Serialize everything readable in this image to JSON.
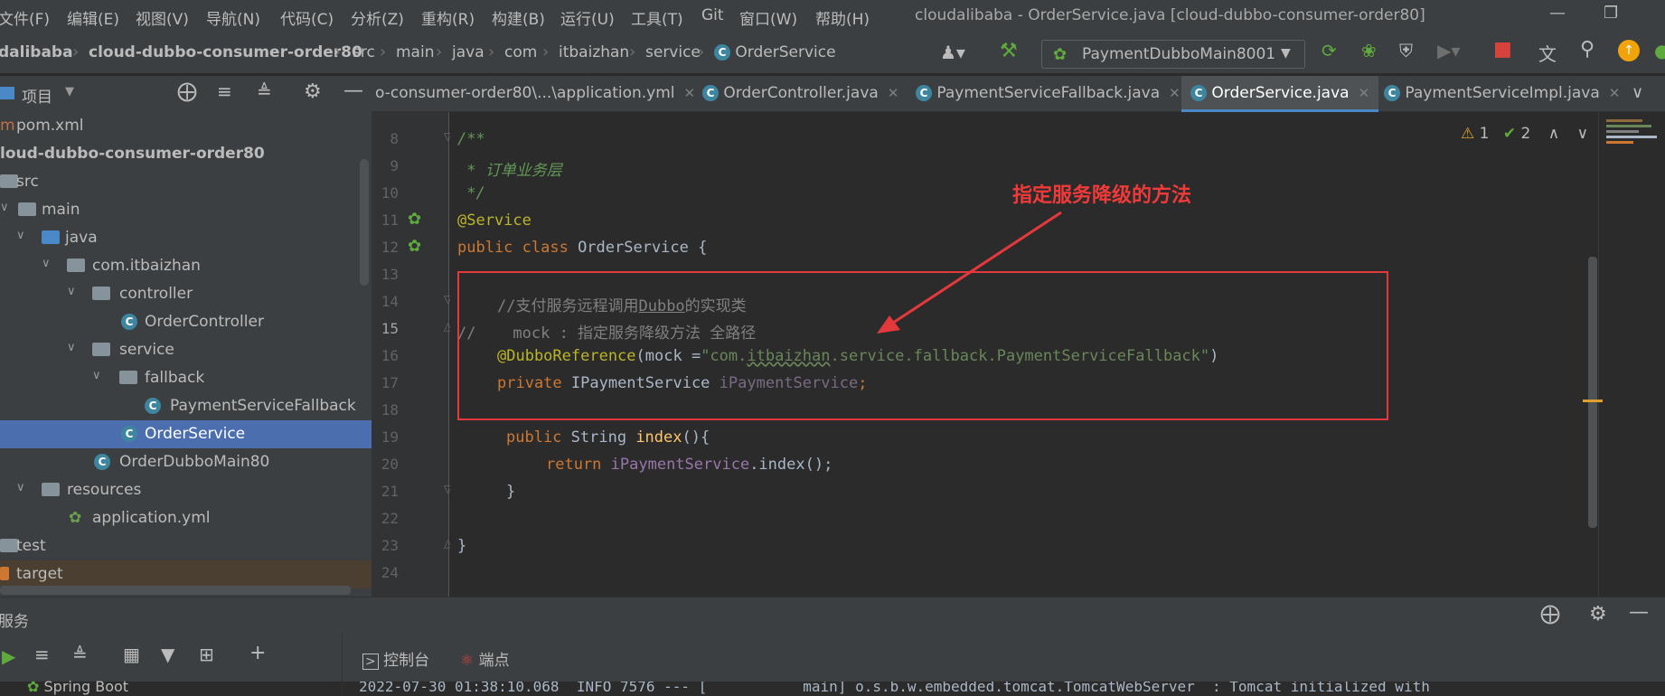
{
  "menu": [
    "文件(F)",
    "编辑(E)",
    "视图(V)",
    "导航(N)",
    "代码(C)",
    "分析(Z)",
    "重构(R)",
    "构建(B)",
    "运行(U)",
    "工具(T)",
    "Git",
    "窗口(W)",
    "帮助(H)"
  ],
  "window_title": "cloudalibaba - OrderService.java [cloud-dubbo-consumer-order80]",
  "breadcrumbs": [
    "dalibaba",
    "cloud-dubbo-consumer-order80",
    "src",
    "main",
    "java",
    "com",
    "itbaizhan",
    "service",
    "OrderService"
  ],
  "run_config": "PaymentDubboMain8001",
  "project_panel": {
    "title": "项目"
  },
  "tree": [
    {
      "label": "pom.xml",
      "depth": 0,
      "type": "file"
    },
    {
      "label": "loud-dubbo-consumer-order80",
      "depth": 0,
      "type": "module"
    },
    {
      "label": "src",
      "depth": 0,
      "type": "folder"
    },
    {
      "label": "main",
      "depth": 1,
      "type": "folder"
    },
    {
      "label": "java",
      "depth": 2,
      "type": "folder-blue"
    },
    {
      "label": "com.itbaizhan",
      "depth": 3,
      "type": "package"
    },
    {
      "label": "controller",
      "depth": 4,
      "type": "package"
    },
    {
      "label": "OrderController",
      "depth": 5,
      "type": "class"
    },
    {
      "label": "service",
      "depth": 4,
      "type": "package"
    },
    {
      "label": "fallback",
      "depth": 5,
      "type": "package"
    },
    {
      "label": "PaymentServiceFallback",
      "depth": 6,
      "type": "class"
    },
    {
      "label": "OrderService",
      "depth": 5,
      "type": "class",
      "selected": true
    },
    {
      "label": "OrderDubboMain80",
      "depth": 4,
      "type": "springclass"
    },
    {
      "label": "resources",
      "depth": 3,
      "type": "folder"
    },
    {
      "label": "application.yml",
      "depth": 4,
      "type": "yml"
    },
    {
      "label": "test",
      "depth": 0,
      "type": "folder"
    },
    {
      "label": "target",
      "depth": 0,
      "type": "folder-orange"
    }
  ],
  "tabs": [
    {
      "label": "o-consumer-order80\\...\\application.yml",
      "active": false
    },
    {
      "label": "OrderController.java",
      "active": false
    },
    {
      "label": "PaymentServiceFallback.java",
      "active": false
    },
    {
      "label": "OrderService.java",
      "active": true
    },
    {
      "label": "PaymentServiceImpl.java",
      "active": false
    }
  ],
  "inspections": {
    "warnings": "1",
    "ok": "2"
  },
  "line_numbers": [
    "8",
    "9",
    "10",
    "11",
    "12",
    "13",
    "14",
    "15",
    "16",
    "17",
    "18",
    "19",
    "20",
    "21",
    "22",
    "23",
    "24"
  ],
  "code": {
    "l8": "/**",
    "l9": " * 订单业务层",
    "l10": " */",
    "l11": "@Service",
    "l12_kw": "public class ",
    "l12_name": "OrderService",
    "l12_rest": " {",
    "l14_a": "//支付服务远程调用",
    "l14_b": "Dubbo",
    "l14_c": "的实现类",
    "l15": "//    mock : 指定服务降级方法 全路径",
    "l16_ann": "@DubboReference",
    "l16_mid": "(mock =",
    "l16_str_a": "\"com.",
    "l16_str_b": "itbaizhan",
    "l16_str_c": ".service.fallback.PaymentServiceFallback\"",
    "l16_end": ")",
    "l17_kw": "private ",
    "l17_type": "IPaymentService ",
    "l17_field": "iPaymentService",
    "l17_end": ";",
    "l19_kw": "public ",
    "l19_type": "String ",
    "l19_fn": "index",
    "l19_end": "(){",
    "l20_kw": "return ",
    "l20_field": "iPaymentService",
    "l20_end": ".index();",
    "l21": "}",
    "l23": "}"
  },
  "annotation": "指定服务降级的方法",
  "services_panel": {
    "title": "服务",
    "tabs": [
      "控制台",
      "端点"
    ],
    "tree_item": "Spring Boot",
    "console_line": "2022-07-30 01:38:10.068  INFO 7576 --- [           main] o.s.b.w.embedded.tomcat.TomcatWebServer  : Tomcat initialized with"
  },
  "colors": {
    "accent": "#4a88c7",
    "annotation_red": "#e4393c",
    "selection": "#4b6eaf"
  }
}
